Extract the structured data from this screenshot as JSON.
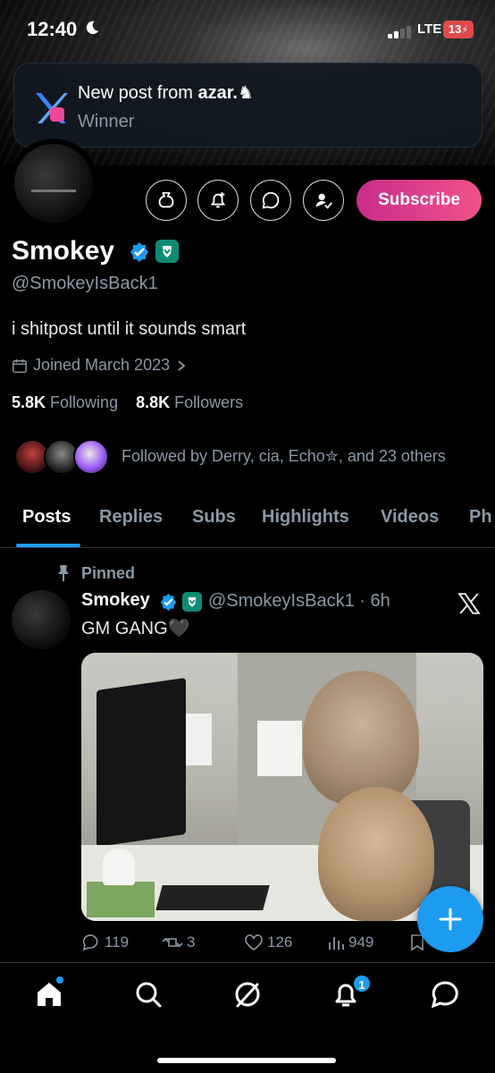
{
  "status_bar": {
    "time": "12:40",
    "network": "LTE",
    "battery": "13"
  },
  "notification": {
    "title_prefix": "New post from ",
    "author": "azar.♞",
    "message": "Winner"
  },
  "profile": {
    "name": "Smokey",
    "handle": "@SmokeyIsBack1",
    "bio": "i shitpost until it sounds smart",
    "joined": "Joined March 2023",
    "following_count": "5.8K",
    "following_label": "Following",
    "followers_count": "8.8K",
    "followers_label": "Followers",
    "followed_by": "Followed by Derry, cia, Echo✮, and 23 others"
  },
  "actions": {
    "subscribe_label": "Subscribe"
  },
  "tabs": [
    {
      "label": "Posts",
      "active": true
    },
    {
      "label": "Replies"
    },
    {
      "label": "Subs"
    },
    {
      "label": "Highlights"
    },
    {
      "label": "Videos"
    },
    {
      "label": "Photos"
    }
  ],
  "post": {
    "pinned_label": "Pinned",
    "author": "Smokey",
    "handle_time": "@SmokeyIsBack1 · 6h",
    "text": "GM GANG🖤",
    "replies": "119",
    "reposts": "3",
    "likes": "126",
    "views": "949"
  },
  "nav": {
    "notifications_badge": "1"
  },
  "colors": {
    "accent": "#1d9bf0",
    "subscribe_gradient": [
      "#c82c8b",
      "#f0548a"
    ],
    "verified_badge": "#0f8b73"
  }
}
